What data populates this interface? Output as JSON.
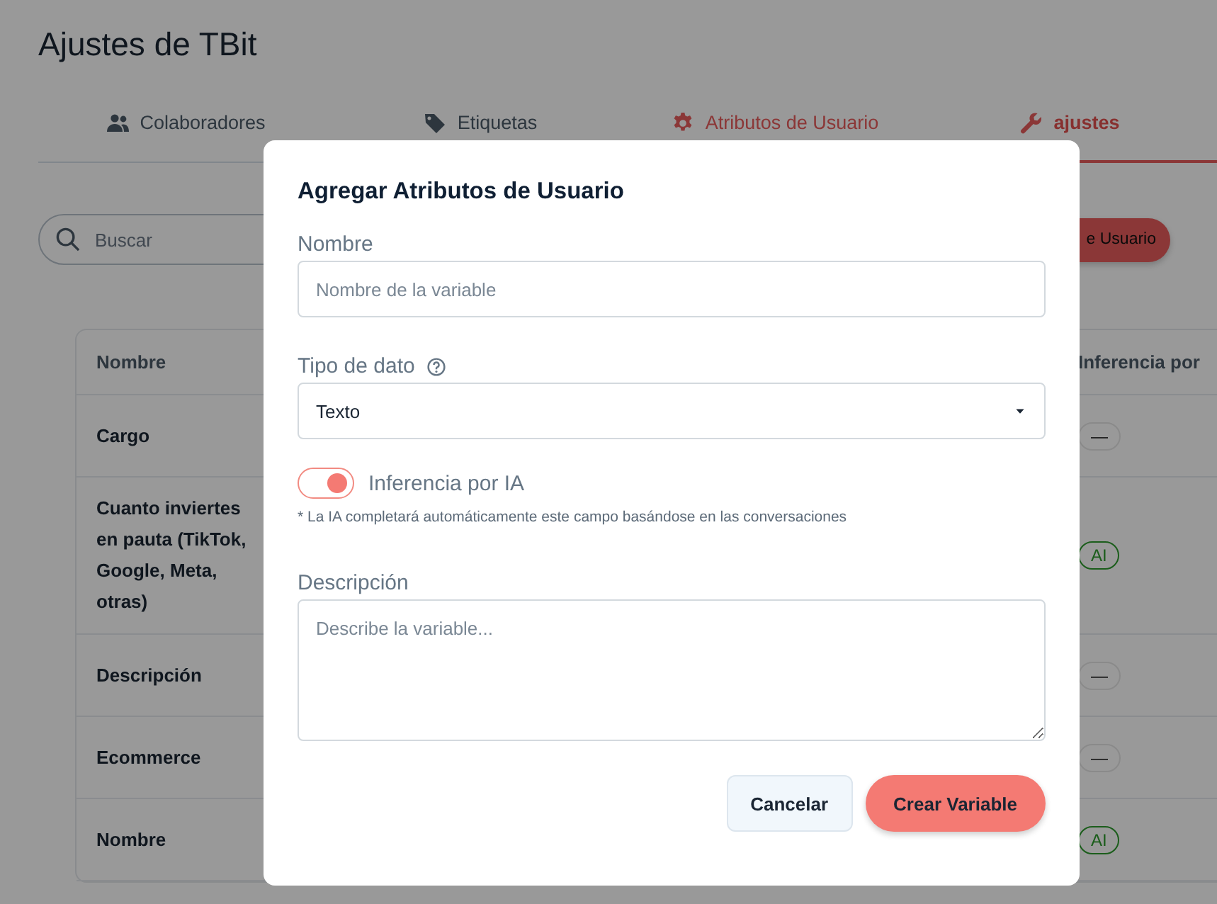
{
  "page": {
    "title": "Ajustes de TBit"
  },
  "tabs": [
    {
      "label": "Colaboradores",
      "selected": false,
      "hovered": false
    },
    {
      "label": "Etiquetas",
      "selected": false,
      "hovered": false
    },
    {
      "label": "Atributos de Usuario",
      "selected": false,
      "hovered": true
    },
    {
      "label": "ajustes",
      "selected": true,
      "hovered": false
    }
  ],
  "search": {
    "placeholder": "Buscar"
  },
  "add_button": {
    "label": "e Usuario"
  },
  "table": {
    "columns": [
      "Nombre",
      "Inferencia por"
    ],
    "rows": [
      {
        "name": "Cargo",
        "ai": false,
        "badge": "—"
      },
      {
        "name": "Cuanto inviertes en pauta (TikTok, Google, Meta, otras)",
        "ai": true,
        "badge": "AI"
      },
      {
        "name": "Descripción",
        "ai": false,
        "badge": "—"
      },
      {
        "name": "Ecommerce",
        "ai": false,
        "badge": "—"
      },
      {
        "name": "Nombre",
        "ai": true,
        "badge": "AI"
      }
    ]
  },
  "dialog": {
    "title": "Agregar Atributos de Usuario",
    "name_label": "Nombre",
    "name_field": {
      "placeholder": "Nombre de la variable"
    },
    "type_label": "Tipo de dato",
    "type_select": {
      "value": "Texto"
    },
    "ai_toggle": {
      "label": "Inferencia por IA",
      "on": true
    },
    "ai_note": "* La IA completará automáticamente este campo basándose en las conversaciones",
    "description_label": "Descripción",
    "description_field": {
      "placeholder": "Describe la variable..."
    },
    "buttons": [
      {
        "label": "Cancelar",
        "kind": "secondary"
      },
      {
        "label": "Crear Variable",
        "kind": "primary"
      }
    ]
  }
}
